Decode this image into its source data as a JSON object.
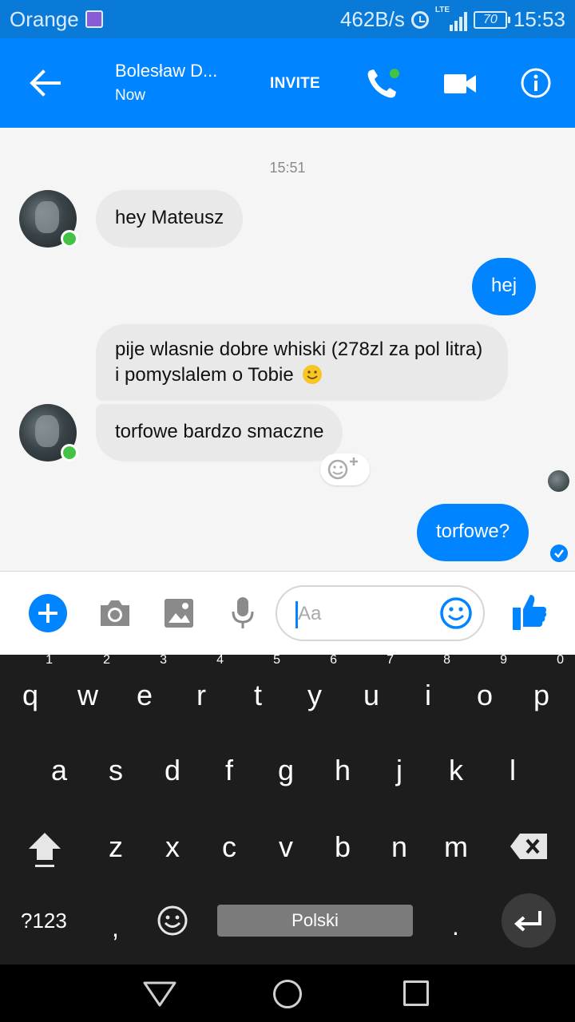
{
  "status_bar": {
    "carrier": "Orange",
    "network_speed": "462B/s",
    "network_type": "LTE",
    "battery": "70",
    "time": "15:53"
  },
  "header": {
    "contact_name": "Bolesław D...",
    "contact_status": "Now",
    "invite_label": "INVITE",
    "icons": [
      "back-arrow-icon",
      "phone-icon",
      "video-camera-icon",
      "info-icon"
    ]
  },
  "conversation": {
    "timestamp": "15:51",
    "messages": [
      {
        "direction": "incoming",
        "text": "hey Mateusz"
      },
      {
        "direction": "outgoing",
        "text": "hej"
      },
      {
        "direction": "incoming",
        "text": "pije wlasnie dobre whiski (278zl za pol litra) i pomyslalem o Tobie"
      },
      {
        "direction": "incoming",
        "text": "torfowe bardzo smaczne"
      },
      {
        "direction": "outgoing",
        "text": "torfowe?"
      }
    ]
  },
  "composer": {
    "placeholder": "Aa",
    "icons": [
      "plus-icon",
      "camera-icon",
      "image-icon",
      "microphone-icon",
      "emoji-icon",
      "thumbs-up-icon"
    ]
  },
  "keyboard": {
    "row1": [
      {
        "key": "q",
        "hint": "1"
      },
      {
        "key": "w",
        "hint": "2"
      },
      {
        "key": "e",
        "hint": "3"
      },
      {
        "key": "r",
        "hint": "4"
      },
      {
        "key": "t",
        "hint": "5"
      },
      {
        "key": "y",
        "hint": "6"
      },
      {
        "key": "u",
        "hint": "7"
      },
      {
        "key": "i",
        "hint": "8"
      },
      {
        "key": "o",
        "hint": "9"
      },
      {
        "key": "p",
        "hint": "0"
      }
    ],
    "row2": [
      "a",
      "s",
      "d",
      "f",
      "g",
      "h",
      "j",
      "k",
      "l"
    ],
    "row3": [
      "z",
      "x",
      "c",
      "v",
      "b",
      "n",
      "m"
    ],
    "symbols_label": "?123",
    "comma": ",",
    "space_label": "Polski",
    "period": "."
  },
  "colors": {
    "accent": "#0084ff",
    "status_bar": "#0a7ad9",
    "incoming_bubble": "#e9e9e9",
    "online_dot": "#44c244",
    "keyboard_bg": "#1d1d1d"
  }
}
